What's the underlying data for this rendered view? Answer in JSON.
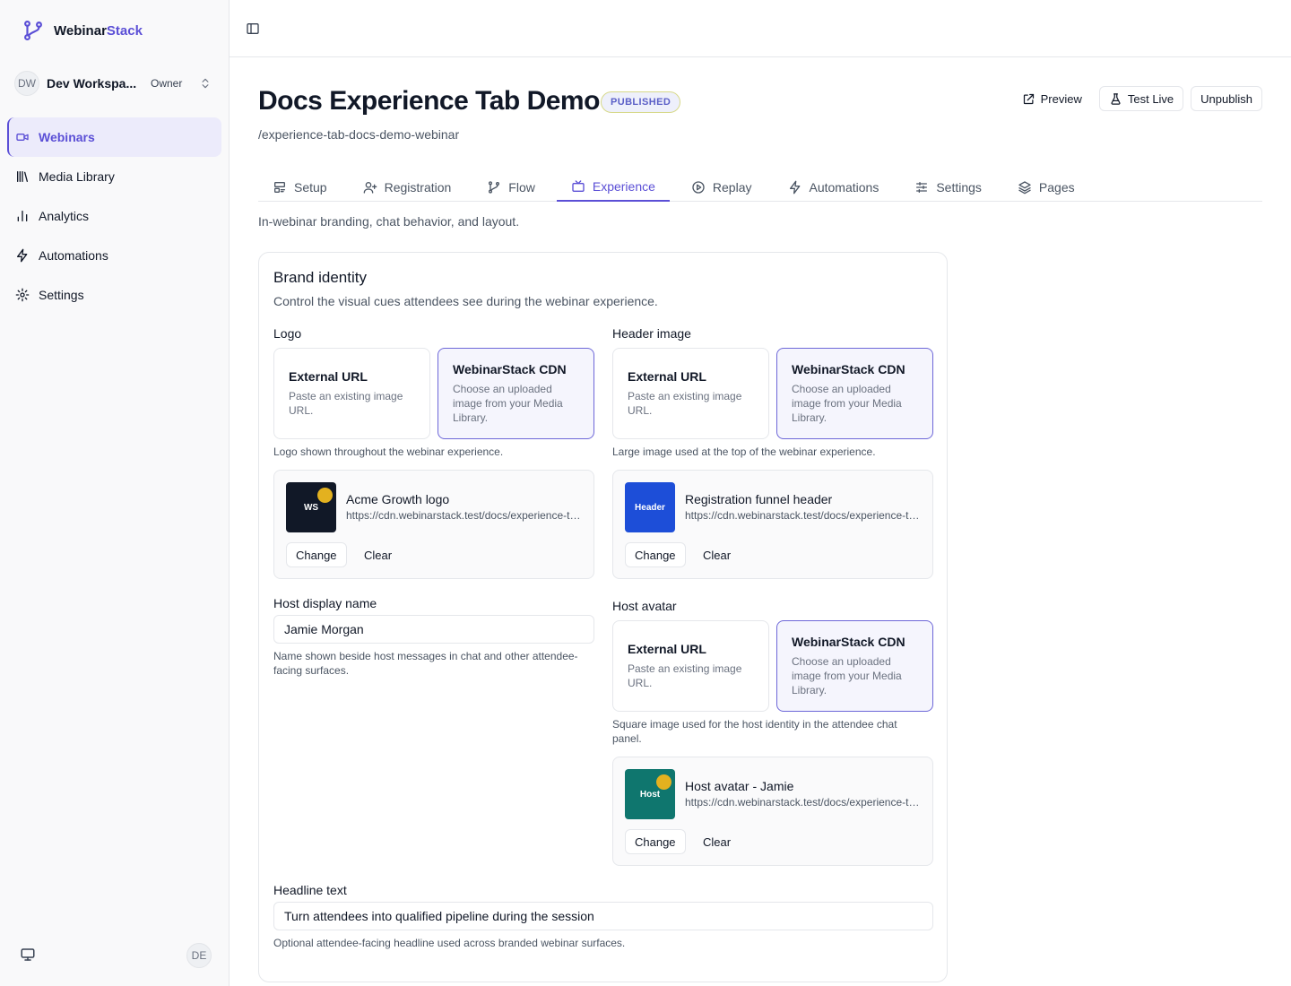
{
  "brand": {
    "name_plain": "Webinar",
    "name_accent": "Stack"
  },
  "workspace": {
    "initials": "DW",
    "name": "Dev Workspa...",
    "role": "Owner"
  },
  "sidebar": {
    "items": [
      {
        "label": "Webinars"
      },
      {
        "label": "Media Library"
      },
      {
        "label": "Analytics"
      },
      {
        "label": "Automations"
      },
      {
        "label": "Settings"
      }
    ],
    "user_initials": "DE"
  },
  "header": {
    "title": "Docs Experience Tab Demo",
    "status": "PUBLISHED",
    "slug": "/experience-tab-docs-demo-webinar",
    "actions": {
      "preview": "Preview",
      "test_live": "Test Live",
      "unpublish": "Unpublish"
    }
  },
  "tabs": [
    {
      "label": "Setup"
    },
    {
      "label": "Registration"
    },
    {
      "label": "Flow"
    },
    {
      "label": "Experience"
    },
    {
      "label": "Replay"
    },
    {
      "label": "Automations"
    },
    {
      "label": "Settings"
    },
    {
      "label": "Pages"
    }
  ],
  "tab_description": "In-webinar branding, chat behavior, and layout.",
  "brand_identity": {
    "title": "Brand identity",
    "subtitle": "Control the visual cues attendees see during the webinar experience.",
    "source_options": {
      "external": {
        "title": "External URL",
        "desc": "Paste an existing image URL."
      },
      "cdn": {
        "title": "WebinarStack CDN",
        "desc": "Choose an uploaded image from your Media Library."
      }
    },
    "logo": {
      "label": "Logo",
      "help": "Logo shown throughout the webinar experience.",
      "asset": {
        "thumb": "WS",
        "name": "Acme Growth logo",
        "url": "https://cdn.webinarstack.test/docs/experience-tab/acme-growth-logo.png"
      }
    },
    "header_image": {
      "label": "Header image",
      "help": "Large image used at the top of the webinar experience.",
      "asset": {
        "thumb": "Header",
        "name": "Registration funnel header",
        "url": "https://cdn.webinarstack.test/docs/experience-tab/registration-funnel-header.png"
      }
    },
    "host_display_name": {
      "label": "Host display name",
      "value": "Jamie Morgan",
      "help": "Name shown beside host messages in chat and other attendee-facing surfaces."
    },
    "host_avatar": {
      "label": "Host avatar",
      "help": "Square image used for the host identity in the attendee chat panel.",
      "asset": {
        "thumb": "Host",
        "name": "Host avatar - Jamie",
        "url": "https://cdn.webinarstack.test/docs/experience-tab/host-avatar-jamie.png"
      }
    },
    "headline": {
      "label": "Headline text",
      "value": "Turn attendees into qualified pipeline during the session",
      "help": "Optional attendee-facing headline used across branded webinar surfaces."
    },
    "buttons": {
      "change": "Change",
      "clear": "Clear"
    }
  },
  "colors": {
    "accent": "#5b4fd6",
    "logo_thumb_bg": "#111827",
    "header_thumb_bg": "#1d4ed8",
    "host_thumb_bg": "#0f766e",
    "thumb_dot": "#e3b11f"
  }
}
